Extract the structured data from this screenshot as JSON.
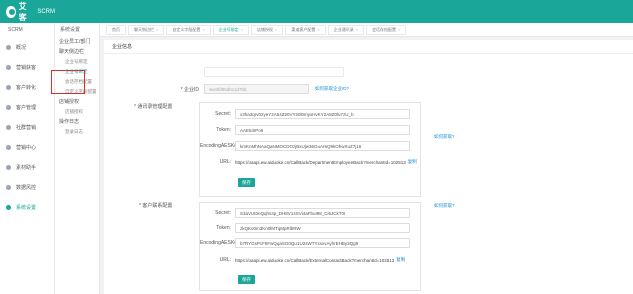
{
  "app": {
    "brand_name": "艾客",
    "product": "SCRM"
  },
  "left_nav": {
    "header": "SCRM",
    "items": [
      {
        "label": "概况",
        "icon": "home-icon",
        "active": false
      },
      {
        "label": "营销获客",
        "icon": "megaphone-icon",
        "active": false
      },
      {
        "label": "客户转化",
        "icon": "users-icon",
        "active": false
      },
      {
        "label": "客户管理",
        "icon": "user-icon",
        "active": false
      },
      {
        "label": "社群营销",
        "icon": "group-icon",
        "active": false
      },
      {
        "label": "营销中心",
        "icon": "target-icon",
        "active": false
      },
      {
        "label": "素材助手",
        "icon": "folder-icon",
        "active": false
      },
      {
        "label": "数据风控",
        "icon": "chart-icon",
        "active": false
      },
      {
        "label": "系统设置",
        "icon": "gear-icon",
        "active": true
      }
    ]
  },
  "sub_nav": {
    "header": "系统设置",
    "groups": [
      {
        "title": "企业员工/部门",
        "items": []
      },
      {
        "title": "聊天侧边栏",
        "items": []
      },
      {
        "title": "",
        "items": [
          {
            "label": "企业号绑定",
            "active": false
          },
          {
            "label": "企业号绑定",
            "active": true
          },
          {
            "label": "会话存档配置",
            "active": false
          },
          {
            "label": "自定义字段配置",
            "active": false
          }
        ]
      },
      {
        "title": "店铺授权",
        "items": [
          {
            "label": "店铺授权",
            "active": false
          }
        ]
      },
      {
        "title": "操作日志",
        "items": [
          {
            "label": "登录日志",
            "active": false
          }
        ]
      }
    ]
  },
  "tabs": [
    {
      "label": "首页",
      "active": false
    },
    {
      "label": "聊天侧边栏",
      "active": false
    },
    {
      "label": "自定义字段配置",
      "active": false
    },
    {
      "label": "企业号绑定",
      "active": true
    },
    {
      "label": "店铺授权",
      "active": false
    },
    {
      "label": "渠道客户配置",
      "active": false
    },
    {
      "label": "企业通讯录",
      "active": false
    },
    {
      "label": "会话存档配置",
      "active": false
    }
  ],
  "panel": {
    "title": "企业信息",
    "corp_name_label": "",
    "corp_name_value": "",
    "corp_id_label": "* 企业ID",
    "corp_id_value": "ww3fd96dbc1d7bb",
    "corp_id_link": "如何获取企业ID?",
    "contact_section": {
      "label": "* 通讯录管理配置",
      "secret_label": "Secret:",
      "secret_value": "x3ha3qrv02yeY2A54Z20VY20l0myxHvKY2A8Z0lu7zU_b",
      "token_label": "Token:",
      "token_value": "AAE54IPo6",
      "aes_label": "EncodingAESKey:",
      "aes_value": "kmKnMhNAaQaNMOCDOzjBxUjw36GuAr6Q9kOhwXuZ7j16",
      "url_label": "URL:",
      "url_value": "https://oaapi.ew.aiduoke.cn/CallBack/DepartmentEmployeeBack?merchantId=102513",
      "copy_label": "复制",
      "help_link": "如何获取?",
      "save_label": "保存"
    },
    "customer_section": {
      "label": "* 客户联系配置",
      "secret_label": "Secret:",
      "secret_value": "S3aVUt0nQqhs3p_DH8V14SVi4aFbuI98_Ci5JCkT0I",
      "token_label": "Token:",
      "token_value": "zkQKo0m3Kn0lMTqMpRlbRW",
      "aes_label": "EncodingAESKey:",
      "aes_value": "b7RYGsPcF8FwQqaSG0Qu1U2sWTYxsxvAyhrEHBy3Qg9",
      "url_label": "URL:",
      "url_value": "https://oaapi.ew.aiduoke.cn/CallBack/ExternalContactBack?merchantId=102513",
      "copy_label": "复制",
      "help_link": "如何获取?",
      "save_label": "保存"
    }
  },
  "colors": {
    "brand": "#1aa79a",
    "link": "#1a8cd8",
    "highlight": "#d9302c"
  }
}
